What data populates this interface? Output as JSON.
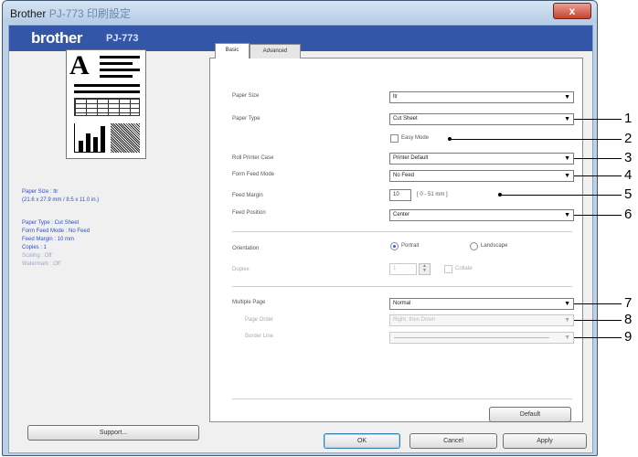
{
  "window": {
    "title": "Brother",
    "title_model": "PJ-773 印刷設定",
    "close_glyph": "x"
  },
  "banner": {
    "brand": "brother",
    "model": "PJ-773"
  },
  "preview_info": [
    "Paper Size : ltr",
    "(21.6 x 27.9 mm / 8.5 x 11.0 in.)",
    "Paper Type : Cut Sheet",
    "Form Feed Mode : No Feed",
    "Feed Margin : 10 mm",
    "Copies : 1",
    "Scaling : Off",
    "Watermark : Off"
  ],
  "support_button": "Support...",
  "tabs": [
    "Basic",
    "Advanced"
  ],
  "fields": {
    "paper_size": {
      "label": "Paper Size",
      "value": "ltr"
    },
    "paper_type": {
      "label": "Paper Type",
      "value": "Cut Sheet"
    },
    "easy_mode": {
      "label": "Easy Mode"
    },
    "roll_printer_case": {
      "label": "Roll Printer Case",
      "value": "Printer Default"
    },
    "form_feed_mode": {
      "label": "Form Feed Mode",
      "value": "No Feed"
    },
    "feed_margin": {
      "label": "Feed Margin",
      "value": "10",
      "range": "[ 0 - 51 mm ]"
    },
    "feed_position": {
      "label": "Feed Position",
      "value": "Center"
    },
    "orientation": {
      "label": "Orientation",
      "portrait": "Portrait",
      "landscape": "Landscape"
    },
    "duplex": {
      "label": "Duplex",
      "value": "1",
      "collate": "Collate"
    },
    "multiple_page": {
      "label": "Multiple Page",
      "value": "Normal"
    },
    "page_order": {
      "label": "Page Order",
      "value": "Right, then Down"
    },
    "border_line": {
      "label": "Border Line",
      "value": ""
    }
  },
  "default_button": "Default",
  "footer_buttons": {
    "ok": "OK",
    "cancel": "Cancel",
    "apply": "Apply"
  },
  "callouts": [
    "1",
    "2",
    "3",
    "4",
    "5",
    "6",
    "7",
    "8",
    "9"
  ]
}
